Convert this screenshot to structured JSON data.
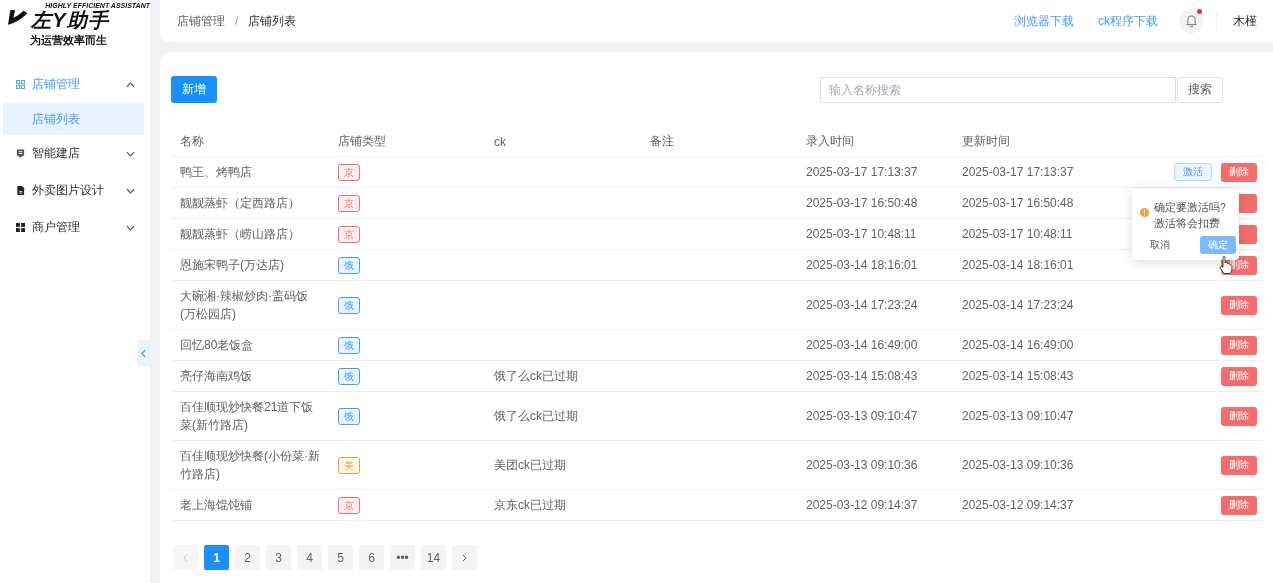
{
  "sidebar": {
    "logo": {
      "tagline_en": "HIGHLY EFFICIENT ASSISTANT",
      "name": "左Y助手",
      "slogan": "为运营效率而生"
    },
    "items": [
      {
        "label": "店铺管理",
        "expanded": true,
        "children": [
          {
            "label": "店铺列表",
            "selected": true
          }
        ]
      },
      {
        "label": "智能建店",
        "expanded": false
      },
      {
        "label": "外卖图片设计",
        "expanded": false
      },
      {
        "label": "商户管理",
        "expanded": false
      }
    ]
  },
  "header": {
    "breadcrumb": [
      "店铺管理",
      "店铺列表"
    ],
    "breadcrumb_separator": "/",
    "links": [
      "浏览器下载",
      "ck程序下载"
    ],
    "notification": true,
    "user": "木槿"
  },
  "toolbar": {
    "add_button": "新增",
    "search": {
      "placeholder": "输入名称搜索",
      "button": "搜索"
    }
  },
  "table": {
    "columns": [
      "名称",
      "店铺类型",
      "ck",
      "备注",
      "录入时间",
      "更新时间"
    ],
    "rows": [
      {
        "name": "鸭王、烤鸭店",
        "tag": {
          "text": "京",
          "color": "#f56c6c"
        },
        "ck": "",
        "remark": "",
        "created": "2025-03-17 17:13:37",
        "updated": "2025-03-17 17:13:37",
        "actions": [
          {
            "kind": "activate",
            "label": "激活"
          },
          {
            "kind": "delete",
            "label": "删除"
          }
        ]
      },
      {
        "name": "靓靓蒸虾（定西路店）",
        "tag": {
          "text": "京",
          "color": "#f56c6c"
        },
        "ck": "",
        "remark": "",
        "created": "2025-03-17 16:50:48",
        "updated": "2025-03-17 16:50:48",
        "actions": [
          {
            "kind": "delete_covered"
          }
        ]
      },
      {
        "name": "靓靓蒸虾（崂山路店）",
        "tag": {
          "text": "京",
          "color": "#f56c6c"
        },
        "ck": "",
        "remark": "",
        "created": "2025-03-17 10:48:11",
        "updated": "2025-03-17 10:48:11",
        "actions": [
          {
            "kind": "delete_covered"
          }
        ]
      },
      {
        "name": "恩施宋鸭子(万达店)",
        "tag": {
          "text": "饿",
          "color": "#409eff"
        },
        "ck": "",
        "remark": "",
        "created": "2025-03-14 18:16:01",
        "updated": "2025-03-14 18:16:01",
        "actions": [
          {
            "kind": "delete",
            "label": "删除"
          }
        ]
      },
      {
        "name": "大碗湘·辣椒炒肉·盖码饭(万松园店)",
        "tag": {
          "text": "饿",
          "color": "#409eff"
        },
        "ck": "",
        "remark": "",
        "created": "2025-03-14 17:23:24",
        "updated": "2025-03-14 17:23:24",
        "actions": [
          {
            "kind": "delete",
            "label": "删除"
          }
        ]
      },
      {
        "name": "回忆80老饭盒",
        "tag": {
          "text": "饿",
          "color": "#409eff"
        },
        "ck": "",
        "remark": "",
        "created": "2025-03-14 16:49:00",
        "updated": "2025-03-14 16:49:00",
        "actions": [
          {
            "kind": "delete",
            "label": "删除"
          }
        ]
      },
      {
        "name": "亮仔海南鸡饭",
        "tag": {
          "text": "饿",
          "color": "#409eff"
        },
        "ck": "饿了么ck已过期",
        "remark": "",
        "created": "2025-03-14 15:08:43",
        "updated": "2025-03-14 15:08:43",
        "actions": [
          {
            "kind": "delete",
            "label": "删除"
          }
        ]
      },
      {
        "name": "百佳顺现炒快餐21道下饭菜(新竹路店)",
        "tag": {
          "text": "饿",
          "color": "#409eff"
        },
        "ck": "饿了么ck已过期",
        "remark": "",
        "created": "2025-03-13 09:10:47",
        "updated": "2025-03-13 09:10:47",
        "actions": [
          {
            "kind": "delete",
            "label": "删除"
          }
        ]
      },
      {
        "name": "百佳顺现炒快餐(小份菜·新竹路店)",
        "tag": {
          "text": "美",
          "color": "#e6a23c"
        },
        "ck": "美团ck已过期",
        "remark": "",
        "created": "2025-03-13 09:10:36",
        "updated": "2025-03-13 09:10:36",
        "actions": [
          {
            "kind": "delete",
            "label": "删除"
          }
        ]
      },
      {
        "name": "老上海馄饨铺",
        "tag": {
          "text": "京",
          "color": "#f56c6c"
        },
        "ck": "京东ck已过期",
        "remark": "",
        "created": "2025-03-12 09:14:37",
        "updated": "2025-03-12 09:14:37",
        "actions": [
          {
            "kind": "delete",
            "label": "删除"
          }
        ]
      }
    ]
  },
  "popconfirm": {
    "message": "确定要激活吗?激活将会扣费",
    "cancel": "取消",
    "confirm": "确定"
  },
  "pagination": {
    "prev_disabled": true,
    "pages": [
      {
        "label": "1",
        "selected": true
      },
      {
        "label": "2",
        "selected": false
      },
      {
        "label": "3",
        "selected": false
      },
      {
        "label": "4",
        "selected": false
      },
      {
        "label": "5",
        "selected": false
      },
      {
        "label": "6",
        "selected": false
      },
      {
        "label": "•••",
        "selected": false
      },
      {
        "label": "14",
        "selected": false
      }
    ]
  }
}
